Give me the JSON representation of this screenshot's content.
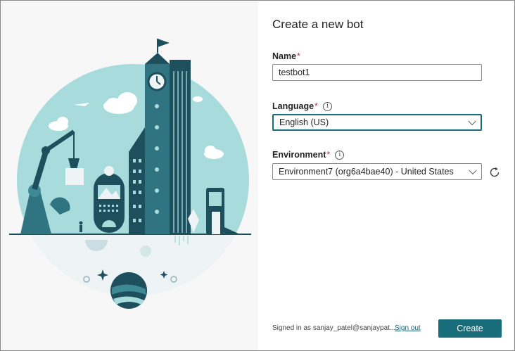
{
  "dialog": {
    "title": "Create a new bot",
    "name_label": "Name",
    "name_value": "testbot1",
    "language_label": "Language",
    "language_value": "English (US)",
    "environment_label": "Environment",
    "environment_value": "Environment7 (org6a4bae40) - United States",
    "required_marker": "*",
    "info_glyph": "i"
  },
  "footer": {
    "signed_in_text": "Signed in as sanjay_patel@sanjaypat...",
    "sign_out_label": "Sign out",
    "create_label": "Create"
  },
  "colors": {
    "accent": "#196d7a",
    "required": "#c4314b",
    "illustration_teal": "#a8dcdc",
    "illustration_dark": "#1e4f5c"
  }
}
